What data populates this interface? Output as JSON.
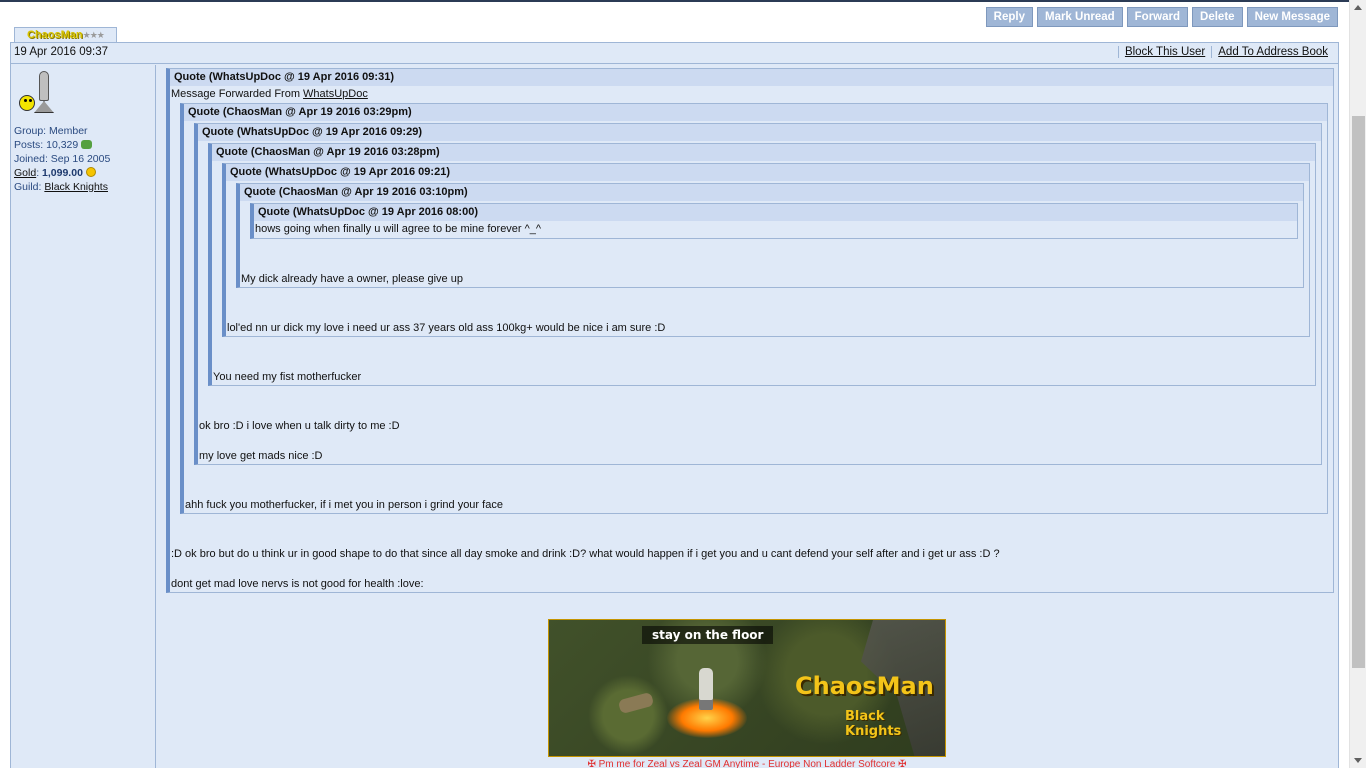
{
  "toolbar": {
    "buttons": [
      "Reply",
      "Mark Unread",
      "Forward",
      "Delete",
      "New Message"
    ]
  },
  "author": {
    "name": "ChaosMan",
    "group": "Group: Member",
    "posts_label": "Posts:",
    "posts": "10,329",
    "joined": "Joined: Sep 16 2005",
    "gold_label": "Gold",
    "gold": "1,099.00",
    "guild_label": "Guild:",
    "guild": "Black Knights"
  },
  "post": {
    "date": "19 Apr 2016 09:37",
    "block_user": "Block This User",
    "add_address": "Add To Address Book",
    "forwarded_prefix": "Message Forwarded From ",
    "forwarded_from": "WhatsUpDoc"
  },
  "quotes": [
    {
      "header": "Quote (WhatsUpDoc @ 19 Apr 2016 09:31)"
    },
    {
      "header": "Quote (ChaosMan @ Apr 19 2016 03:29pm)"
    },
    {
      "header": "Quote (WhatsUpDoc @ 19 Apr 2016 09:29)"
    },
    {
      "header": "Quote (ChaosMan @ Apr 19 2016 03:28pm)"
    },
    {
      "header": "Quote (WhatsUpDoc @ 19 Apr 2016 09:21)"
    },
    {
      "header": "Quote (ChaosMan @ Apr 19 2016 03:10pm)"
    },
    {
      "header": "Quote (WhatsUpDoc @ 19 Apr 2016 08:00)"
    }
  ],
  "messages": {
    "q7": "hows going when finally u will agree to be mine forever ^_^",
    "q6": "My dick already have a owner, please give up",
    "q5": "lol'ed nn ur dick my love i need ur ass 37 years old ass 100kg+ would be nice i am sure :D",
    "q4": "You need my fist motherfucker",
    "q3a": "ok bro :D i love when u talk dirty to me :D",
    "q3b": "my love get mads nice :D",
    "q2": "ahh fuck you motherfucker, if i met you in person i grind your face",
    "q1a": ":D ok bro but do u think ur in good shape to do that since all day smoke and drink :D? what would happen if i get you and u cant defend your self after and i get ur ass :D ?",
    "q1b": "dont get mad love nervs is not good for health :love:"
  },
  "signature": {
    "banner_tag": "stay on the floor",
    "banner_name": "ChaosMan",
    "banner_guild": "Black Knights",
    "line": "✠ Pm me for Zeal vs Zeal GM Anytime - Europe Non Ladder Softcore ✠"
  },
  "colors": {
    "accent": "#9fb6d6",
    "quote_header": "#ccdaf1",
    "panel": "#dfe9f7",
    "gold_text": "#f3c419"
  }
}
